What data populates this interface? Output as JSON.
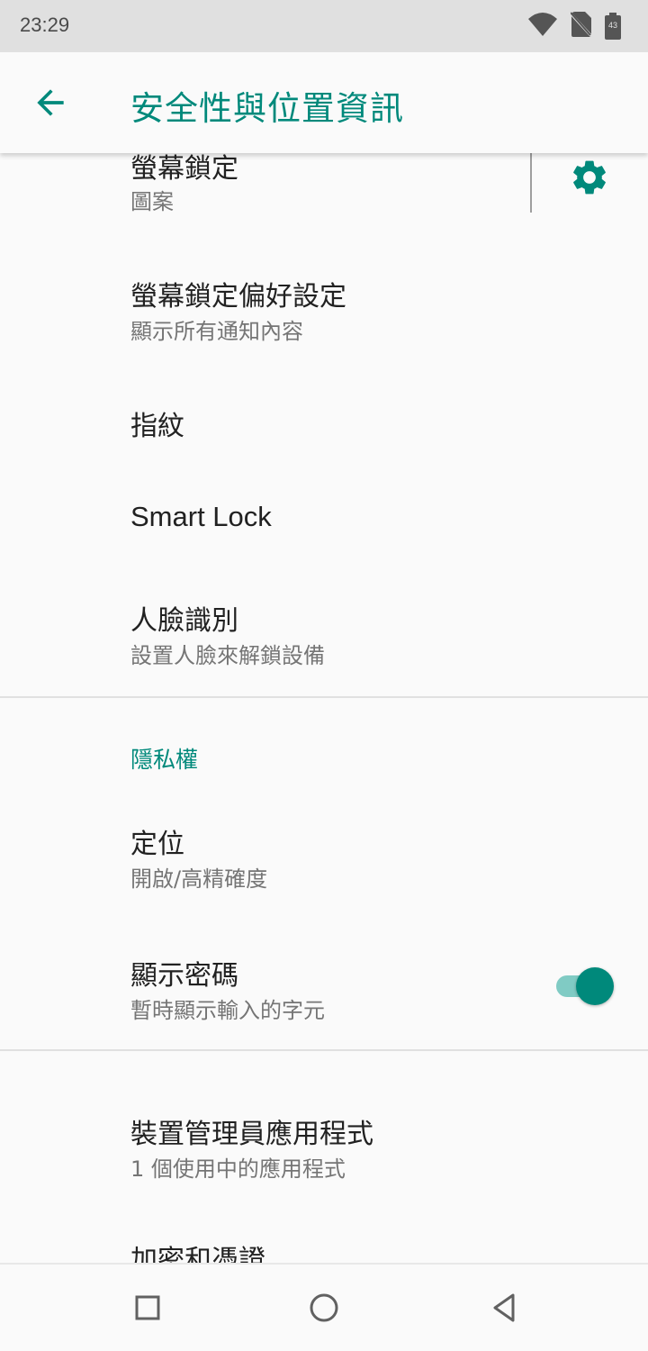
{
  "status_bar": {
    "time": "23:29",
    "battery_level": "43",
    "icons": [
      "wifi-icon",
      "no-sim-icon",
      "battery-icon"
    ]
  },
  "app_bar": {
    "title": "安全性與位置資訊",
    "back_icon": "arrow-back-icon"
  },
  "accent_color": "#00897b",
  "items": [
    {
      "title": "螢幕鎖定",
      "summary": "圖案",
      "action_icon": "gear-icon"
    },
    {
      "title": "螢幕鎖定偏好設定",
      "summary": "顯示所有通知內容"
    },
    {
      "title": "指紋"
    },
    {
      "title": "Smart Lock"
    },
    {
      "title": "人臉識別",
      "summary": "設置人臉來解鎖設備"
    }
  ],
  "privacy_section": {
    "header": "隱私權",
    "items": [
      {
        "title": "定位",
        "summary": "開啟/高精確度"
      },
      {
        "title": "顯示密碼",
        "summary": "暫時顯示輸入的字元",
        "toggle_on": true
      }
    ]
  },
  "admin_section": {
    "items": [
      {
        "title": "裝置管理員應用程式",
        "summary": "1 個使用中的應用程式"
      },
      {
        "title": "加密和憑證"
      }
    ]
  },
  "nav_bar": {
    "buttons": [
      "recents-square-icon",
      "home-circle-icon",
      "back-triangle-icon"
    ]
  }
}
